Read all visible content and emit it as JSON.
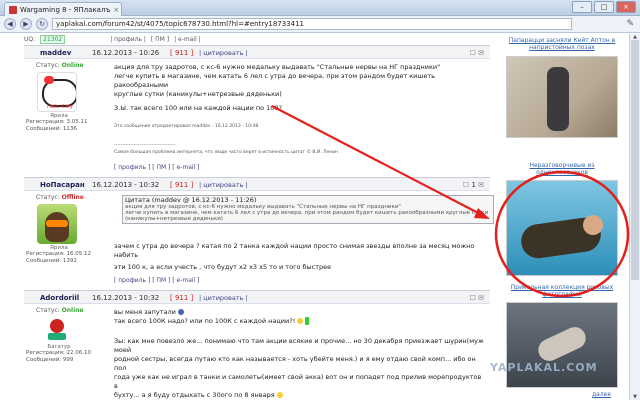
{
  "browser": {
    "tab_title": "Wargaming 8 - ЯПлакалъ",
    "tab_close": "×",
    "url": "yaplakal.com/forum42/st/4075/topic678730.html?hl=#entry18733411",
    "window_buttons": [
      "–",
      "□",
      "×"
    ]
  },
  "topline": {
    "uq_label": "UQ:",
    "uq_value": "21302",
    "links": [
      "| профиль |",
      "[ ПМ ]",
      "| e-mail |"
    ]
  },
  "posts": [
    {
      "username": "maddev",
      "date": "16.12.2013 - 10:26",
      "num": "[ 911 ]",
      "links": "| цитировать |",
      "status_label": "Статус:",
      "status_value": "Online",
      "rank": "Ярила",
      "avatar_text": "Hello Kitty",
      "reg": "Регистрация: 3.05.11",
      "posts_count": "Сообщений: 1136",
      "lines": [
        "акция для тру задротов, с кс-6 нужно медальку выдавать \"Стальные нервы на НГ праздники\"",
        "легче купить в магазине, чем катать 6 лел с утра до вечера, при этом рандом будет кишеть ракообразными",
        "круглые сутки (каникулы+нетрезвые дяденьки)"
      ],
      "line2": "З.Ы. так всего 100 или на каждой нации по 100?",
      "edited": "Это сообщение отредактировал maddev - 16.12.2013 - 10:48",
      "sig_line": "--------------------------------------",
      "sig": "Самая большая проблема интернета, что люди часто верят в истинность цитат © В.И. Ленин",
      "foot": "[ профиль ]  [ ПМ ]  [ e-mail ]"
    },
    {
      "username": "HoПасаран",
      "date": "16.12.2013 - 10:32",
      "num": "[ 911 ]",
      "links": "| цитировать |",
      "counter": "1",
      "status_label": "Статус:",
      "status_value": "Offline",
      "rank": "Ярила",
      "reg": "Регистрация: 16.05.12",
      "posts_count": "Сообщений: 1392",
      "quote_head": "Цитата (maddev @ 16.12.2013 - 11:26)",
      "quote_lines": [
        "акция для тру задротов, с кс-6 нужно медальку выдавать \"Стальные нервы на НГ праздники\"",
        "легче купить в магазине, чем катать 6 лел с утра до вечера, при этом рандом будет кишеть ракообразными круглые сутки",
        "(каникулы+нетрезвые дяденьки)"
      ],
      "lines": [
        "зачем с утра до вечера ? катая по 2 танка каждой нации просто снимая звезды вполне за месяц можно набить",
        "эти 100 к, а если учесть , что будут х2 х3 х5 то и того быстрее"
      ],
      "foot": "[ профиль ]  [ ПМ ]  [ e-mail ]"
    },
    {
      "username": "Adordoriil",
      "date": "16.12.2013 - 10:32",
      "num": "[ 911 ]",
      "links": "| цитировать |",
      "status_label": "Статус:",
      "status_value": "Online",
      "rank": "Багатур",
      "reg": "Регистрация: 22.06.10",
      "posts_count": "Сообщений: 999",
      "lines": [
        "вы меня запутали",
        "так всего 100К надо? или по 100К с каждой нации?!"
      ],
      "long_lines": [
        "Зы: как мне повезло же... понимаю что там акции всякие и прочие... но 30 декабря приезжает шурин(муж моей",
        "родной сестры, всегда путаю кто как называется - хоть убейте меня.) и я ему отдаю свой комп... ибо он пол",
        "года уже как не играл в танки и самолеты(имеет свой акка) вот он и попадет под прилив морепродуктов в",
        "бухту... а я буду отдыхать с 30ого по 8 января"
      ]
    }
  ],
  "sidebar": {
    "cap1": "Папарацци засняли Кейт Аптон в напристойных позах",
    "cap2": "Неразговорчивые из одноклассников",
    "cap3": "Прикольная коллекция роковых фотографий",
    "next": "далее"
  },
  "watermark": "YAPLAKAL.COM"
}
